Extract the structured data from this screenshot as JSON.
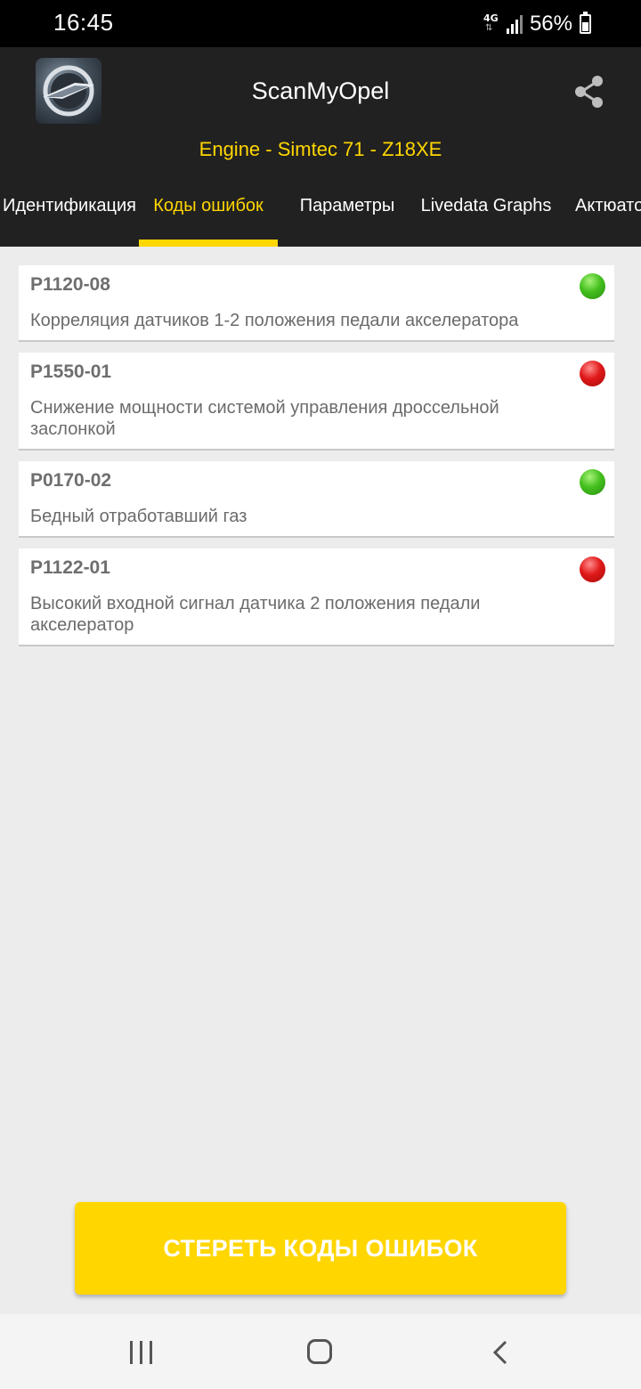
{
  "status_bar": {
    "time": "16:45",
    "network": "4G",
    "battery": "56%",
    "battery_level": 0.56
  },
  "header": {
    "app_title": "ScanMyOpel",
    "subtitle": "Engine - Simtec 71 - Z18XE",
    "share_icon": "share-icon",
    "logo_icon": "opel-logo-icon"
  },
  "tabs": [
    {
      "label": "Идентификация",
      "active": false
    },
    {
      "label": "Коды ошибок",
      "active": true
    },
    {
      "label": "Параметры",
      "active": false
    },
    {
      "label": "Livedata Graphs",
      "active": false
    },
    {
      "label": "Актюато",
      "active": false
    }
  ],
  "codes": [
    {
      "code": "P1120-08",
      "description": "Корреляция датчиков 1-2 положения педали акселератора",
      "status": "green"
    },
    {
      "code": "P1550-01",
      "description": "Снижение мощности системой управления дроссельной заслонкой",
      "status": "red"
    },
    {
      "code": "P0170-02",
      "description": "Бедный отработавший газ",
      "status": "green"
    },
    {
      "code": "P1122-01",
      "description": "Высокий входной сигнал датчика 2 положения педали акселератор",
      "status": "red"
    }
  ],
  "actions": {
    "clear_codes": "СТЕРЕТЬ КОДЫ ОШИБОК"
  },
  "colors": {
    "accent": "#ffd600",
    "header_bg": "#212121",
    "status_ok": "#44c01e",
    "status_error": "#e01818"
  },
  "nav": {
    "recent_icon": "recent-apps-icon",
    "home_icon": "home-icon",
    "back_icon": "back-icon"
  }
}
